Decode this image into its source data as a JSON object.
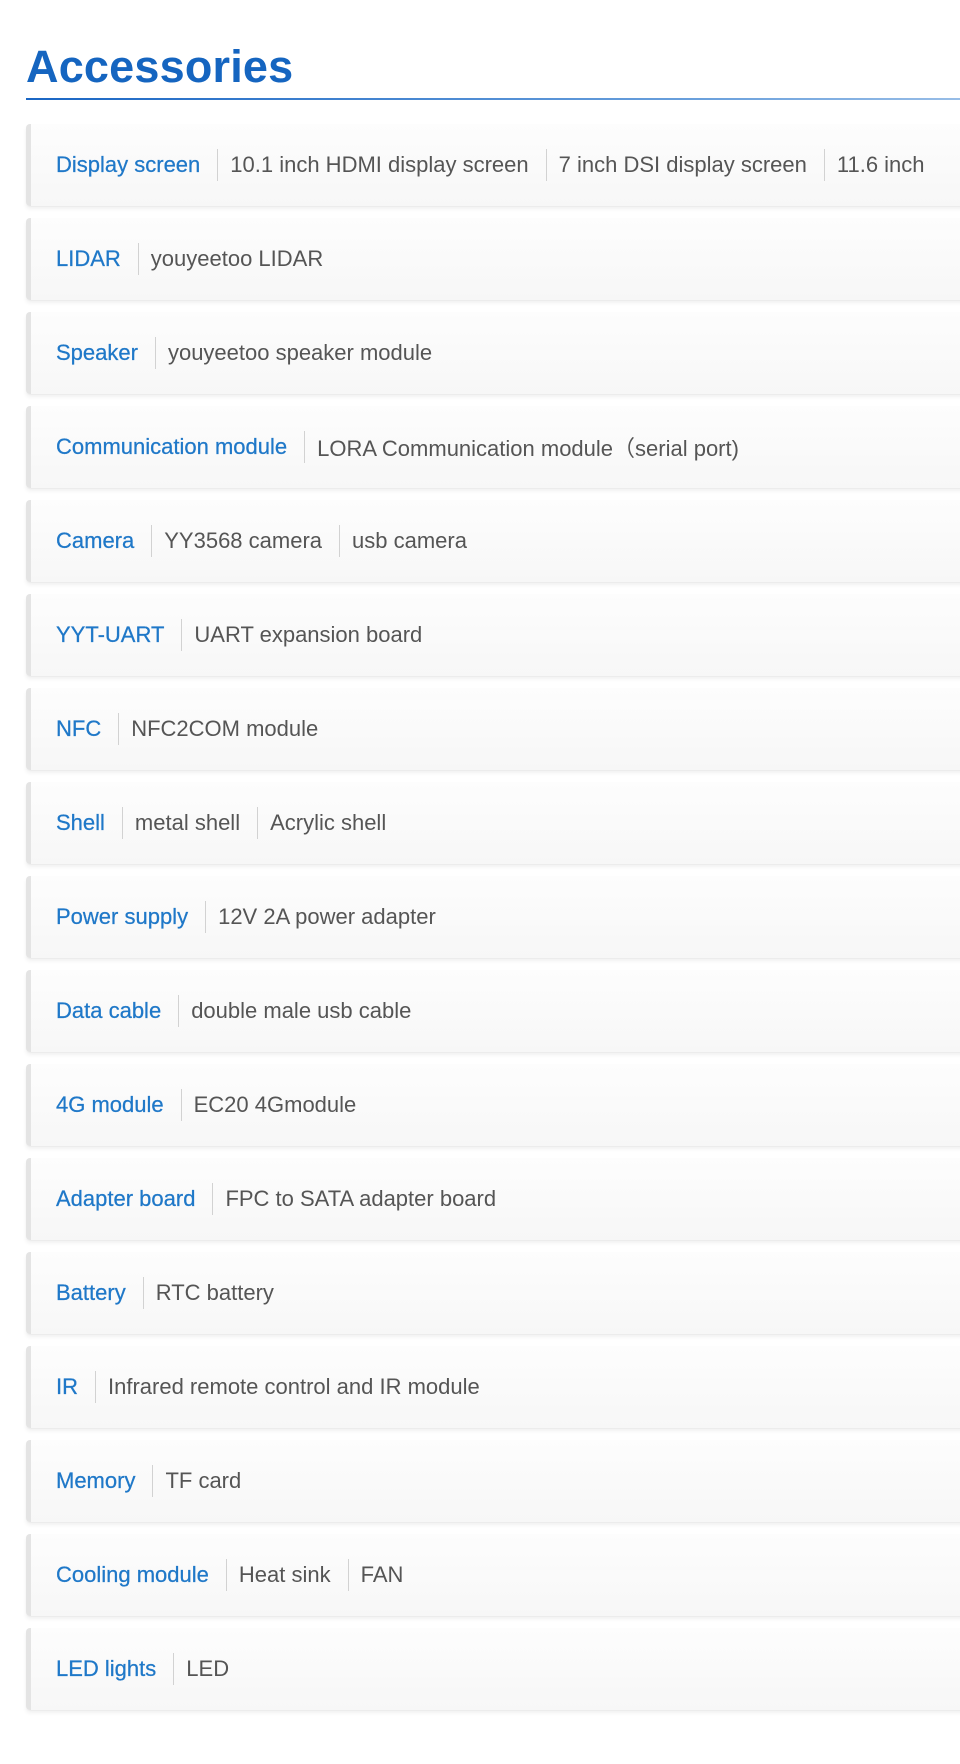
{
  "heading": "Accessories",
  "rows": [
    {
      "category": "Display screen",
      "items": [
        "10.1 inch HDMI display screen",
        "7 inch DSI display screen",
        "11.6 inch"
      ]
    },
    {
      "category": "LIDAR",
      "items": [
        "youyeetoo LIDAR"
      ]
    },
    {
      "category": "Speaker",
      "items": [
        "youyeetoo speaker module"
      ]
    },
    {
      "category": "Communication module",
      "items": [
        "LORA Communication module（serial port)"
      ]
    },
    {
      "category": "Camera",
      "items": [
        "YY3568 camera",
        "usb camera"
      ]
    },
    {
      "category": "YYT-UART",
      "items": [
        "UART expansion board"
      ]
    },
    {
      "category": "NFC",
      "items": [
        "NFC2COM module"
      ]
    },
    {
      "category": "Shell",
      "items": [
        "metal shell",
        "Acrylic shell"
      ]
    },
    {
      "category": "Power supply",
      "items": [
        "12V 2A power adapter"
      ]
    },
    {
      "category": "Data cable",
      "items": [
        "double male usb cable"
      ]
    },
    {
      "category": "4G module",
      "items": [
        "EC20 4Gmodule"
      ]
    },
    {
      "category": "Adapter board",
      "items": [
        "FPC to SATA adapter board"
      ]
    },
    {
      "category": "Battery",
      "items": [
        "RTC battery"
      ]
    },
    {
      "category": "IR",
      "items": [
        "Infrared remote control and IR module"
      ]
    },
    {
      "category": "Memory",
      "items": [
        "TF card"
      ]
    },
    {
      "category": "Cooling module",
      "items": [
        "Heat sink",
        "FAN"
      ]
    },
    {
      "category": "LED lights",
      "items": [
        "LED"
      ]
    }
  ]
}
